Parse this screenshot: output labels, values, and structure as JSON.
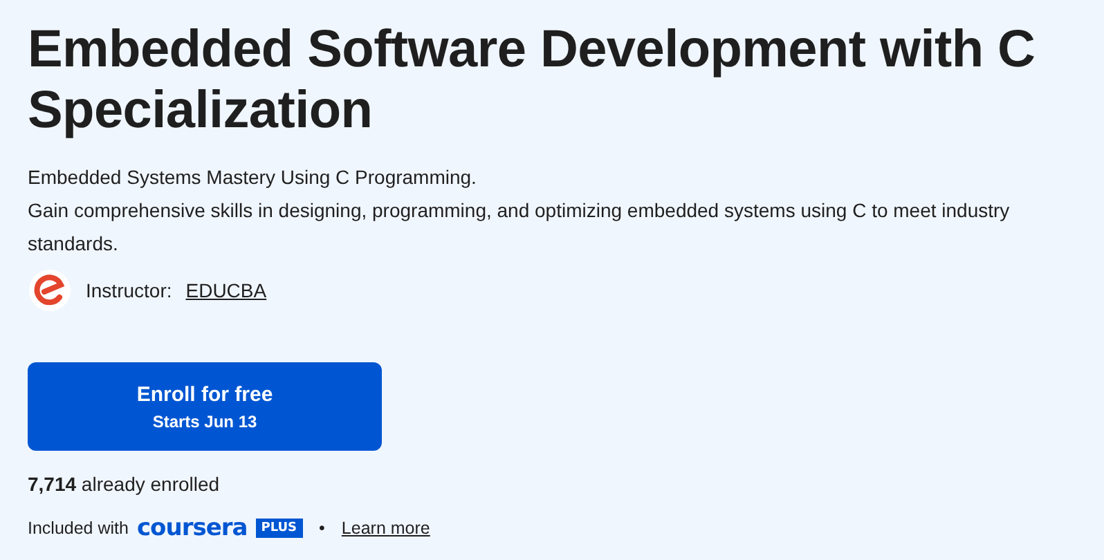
{
  "title": "Embedded Software Development with C Specialization",
  "description": [
    "Embedded Systems Mastery Using C Programming.",
    "Gain comprehensive skills in designing, programming, and optimizing embedded systems using C to meet industry standards."
  ],
  "instructor": {
    "label": "Instructor:",
    "name": "EDUCBA"
  },
  "enroll_button": {
    "label": "Enroll for free",
    "sublabel": "Starts Jun 13"
  },
  "enrolled": "**7,714** already enrolled",
  "included": {
    "text": "Included with",
    "brand": "coursera",
    "badge": "PLUS",
    "separator": "•",
    "link": "Learn more"
  }
}
